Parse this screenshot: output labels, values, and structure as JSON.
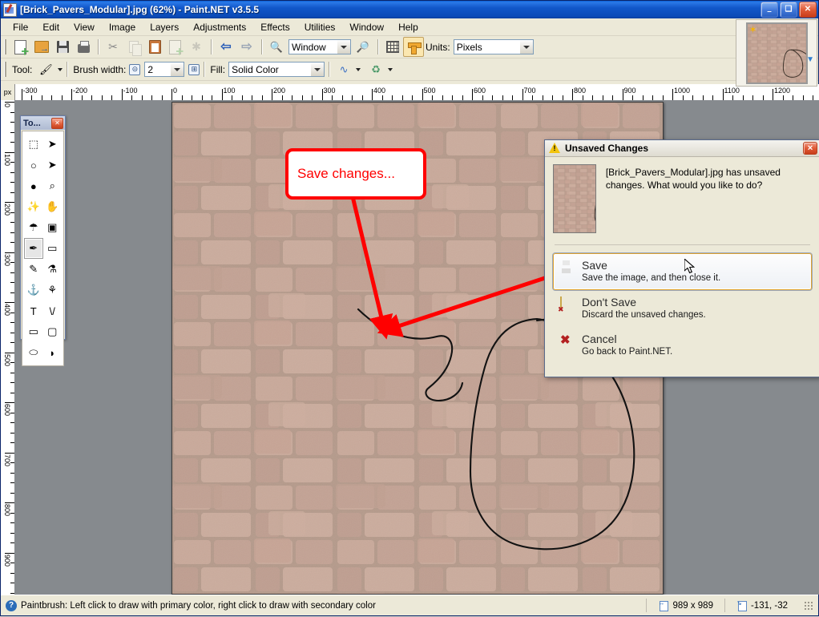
{
  "window": {
    "title": "[Brick_Pavers_Modular].jpg (62%) - Paint.NET v3.5.5",
    "minimize": "–",
    "maximize": "❑",
    "close": "✕"
  },
  "menu": {
    "items": [
      "File",
      "Edit",
      "View",
      "Image",
      "Layers",
      "Adjustments",
      "Effects",
      "Utilities",
      "Window",
      "Help"
    ]
  },
  "toolbar_main": {
    "buttons": [
      {
        "name": "new",
        "title": "New"
      },
      {
        "name": "open",
        "title": "Open"
      },
      {
        "name": "save",
        "title": "Save"
      },
      {
        "name": "print",
        "title": "Print"
      },
      {
        "name": "cut",
        "title": "Cut"
      },
      {
        "name": "copy",
        "title": "Copy"
      },
      {
        "name": "paste",
        "title": "Paste"
      },
      {
        "name": "crop",
        "title": "Crop to Selection"
      },
      {
        "name": "deselect",
        "title": "Deselect All"
      },
      {
        "name": "undo",
        "title": "Undo"
      },
      {
        "name": "redo",
        "title": "Redo"
      },
      {
        "name": "zoom-out",
        "title": "Zoom Out"
      },
      {
        "name": "zoom-in",
        "title": "Zoom In"
      },
      {
        "name": "grid",
        "title": "Show Grid"
      },
      {
        "name": "rulers",
        "title": "Show Rulers"
      }
    ],
    "zoom_value": "Window",
    "units_label": "Units:",
    "units_value": "Pixels"
  },
  "toolbar_tool": {
    "tool_label": "Tool:",
    "tool_value": "Paintbrush",
    "brush_width_label": "Brush width:",
    "brush_width_value": "2",
    "decrease": "⊝",
    "increase": "⊞",
    "fill_label": "Fill:",
    "fill_value": "Solid Color",
    "blend_icon": "curve-icon",
    "antialias_icon": "antialiasing-icon"
  },
  "toolbox": {
    "title": "To...",
    "close": "✕",
    "tools": [
      {
        "name": "rectangle-select",
        "glyph": "⬚",
        "selected": false
      },
      {
        "name": "move-selected",
        "glyph": "➤",
        "selected": false
      },
      {
        "name": "lasso-select",
        "glyph": "○",
        "selected": false
      },
      {
        "name": "move-selection",
        "glyph": "➤",
        "selected": false
      },
      {
        "name": "ellipse-select",
        "glyph": "●",
        "selected": false
      },
      {
        "name": "zoom",
        "glyph": "⌕",
        "selected": false
      },
      {
        "name": "magic-wand",
        "glyph": "✨",
        "selected": false
      },
      {
        "name": "pan",
        "glyph": "✋",
        "selected": false
      },
      {
        "name": "paint-bucket",
        "glyph": "☂",
        "selected": false
      },
      {
        "name": "gradient",
        "glyph": "▣",
        "selected": false
      },
      {
        "name": "paintbrush",
        "glyph": "✒",
        "selected": true
      },
      {
        "name": "eraser",
        "glyph": "▭",
        "selected": false
      },
      {
        "name": "pencil",
        "glyph": "✎",
        "selected": false
      },
      {
        "name": "color-picker",
        "glyph": "⚗",
        "selected": false
      },
      {
        "name": "clone-stamp",
        "glyph": "⚓",
        "selected": false
      },
      {
        "name": "recolor",
        "glyph": "⚘",
        "selected": false
      },
      {
        "name": "text",
        "glyph": "T",
        "selected": false
      },
      {
        "name": "line-curve",
        "glyph": "\\/",
        "selected": false
      },
      {
        "name": "rectangle",
        "glyph": "▭",
        "selected": false
      },
      {
        "name": "rounded-rectangle",
        "glyph": "▢",
        "selected": false
      },
      {
        "name": "ellipse",
        "glyph": "⬭",
        "selected": false
      },
      {
        "name": "freeform-shape",
        "glyph": "◗",
        "selected": false
      }
    ]
  },
  "rulers": {
    "corner_label": "px",
    "horizontal_labels": [
      "-300",
      "-200",
      "-100",
      "0",
      "100",
      "200",
      "300",
      "400",
      "500",
      "600",
      "700",
      "800",
      "900",
      "1000",
      "1100",
      "1200"
    ],
    "vertical_labels": [
      "0",
      "100",
      "200",
      "300",
      "400",
      "500",
      "600",
      "700",
      "800",
      "900"
    ]
  },
  "annotation": {
    "callout_text": "Save changes...",
    "color": "#ff0000"
  },
  "dialog": {
    "title": "Unsaved Changes",
    "close": "✕",
    "message": "[Brick_Pavers_Modular].jpg has unsaved changes. What would you like to do?",
    "options": [
      {
        "label": "Save",
        "description": "Save the image, and then close it.",
        "icon": "save-icon",
        "highlighted": true
      },
      {
        "label": "Don't Save",
        "description": "Discard the unsaved changes.",
        "icon": "dont-save-icon",
        "highlighted": false
      },
      {
        "label": "Cancel",
        "description": "Go back to Paint.NET.",
        "icon": "cancel-icon",
        "highlighted": false
      }
    ]
  },
  "statusbar": {
    "help_glyph": "?",
    "message": "Paintbrush: Left click to draw with primary color, right click to draw with secondary color",
    "image_size": "989 x 989",
    "cursor_position": "-131, -32"
  },
  "colors": {
    "title_blue": "#0a4bb8",
    "chrome": "#ece9d8",
    "workspace": "#868a8e",
    "accent_red": "#ff0000",
    "highlight_orange": "#e0a32e",
    "brick": "#c9a492"
  }
}
